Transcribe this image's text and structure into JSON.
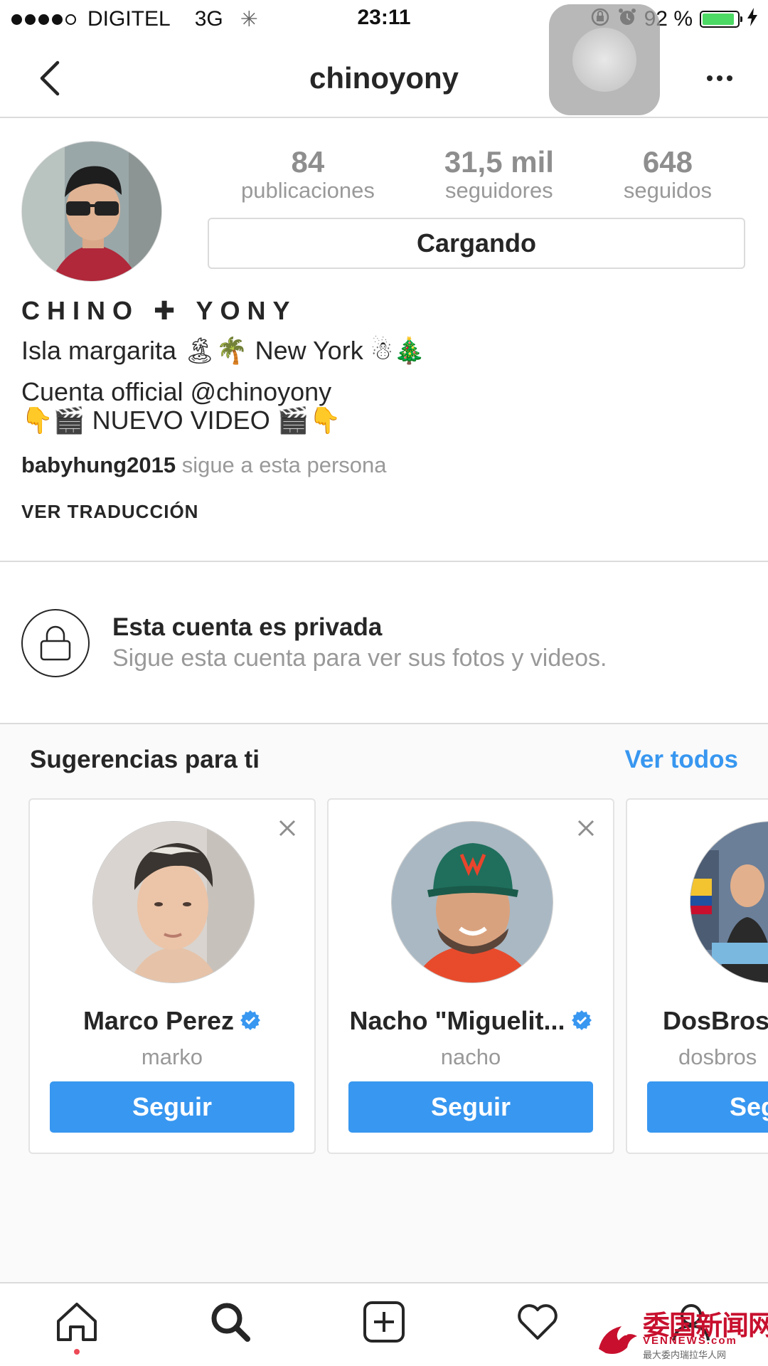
{
  "status_bar": {
    "carrier": "DIGITEL",
    "network": "3G",
    "time": "23:11",
    "battery": "92 %",
    "battery_level": 0.92,
    "battery_color": "#4cd964"
  },
  "nav": {
    "title": "chinoyony",
    "back_icon": "chevron-left-icon",
    "more_icon": "more-horizontal-icon"
  },
  "profile": {
    "stats": [
      {
        "value": "84",
        "label": "publicaciones"
      },
      {
        "value": "31,5 mil",
        "label": "seguidores"
      },
      {
        "value": "648",
        "label": "seguidos"
      }
    ],
    "action_button": "Cargando",
    "display_name": "CHINO ✚ YONY",
    "bio_lines": [
      "Isla margarita 🏝🌴 New York ☃🎄",
      "Cuenta official @chinoyony",
      "👇🎬 NUEVO VIDEO 🎬👇"
    ],
    "followed_by_user": "babyhung2015",
    "followed_by_text": "sigue a esta persona",
    "translate": "VER TRADUCCIÓN"
  },
  "private": {
    "title": "Esta cuenta es privada",
    "subtitle": "Sigue esta cuenta para ver sus fotos y videos."
  },
  "suggestions": {
    "heading": "Sugerencias para ti",
    "see_all": "Ver todos",
    "accent_color": "#3897f0",
    "cards": [
      {
        "name": "Marco Perez",
        "handle": "marko",
        "button": "Seguir",
        "verified": true
      },
      {
        "name": "Nacho \"Miguelit...",
        "handle": "nacho",
        "button": "Seguir",
        "verified": true
      },
      {
        "name": "DosBros",
        "handle": "dosbros",
        "button": "Seguir",
        "verified": false
      }
    ]
  },
  "tab_bar": {
    "items": [
      "home-icon",
      "search-icon",
      "add-post-icon",
      "heart-icon",
      "profile-icon"
    ]
  },
  "watermark": {
    "cn": "委国新闻网",
    "en": "VENNEWS.com",
    "sub": "最大委内瑞拉华人网"
  }
}
